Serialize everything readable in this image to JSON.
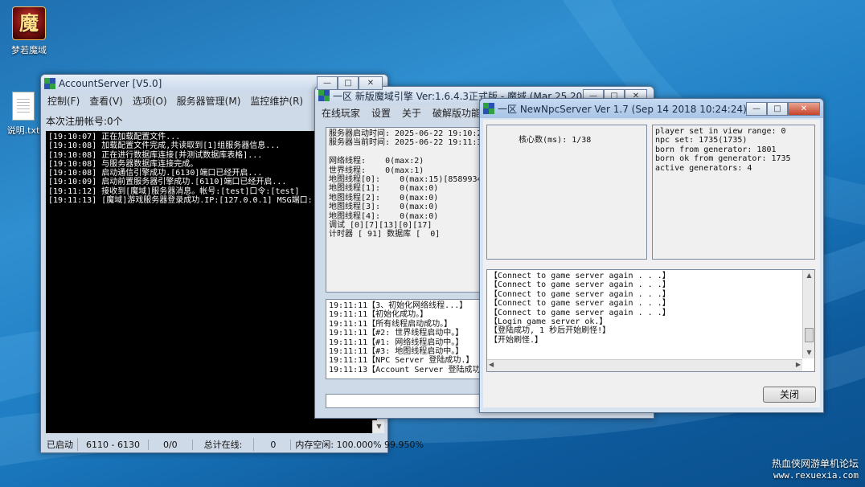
{
  "desktop": {
    "icons": [
      {
        "label": "梦若魔域",
        "glyph": "魔"
      },
      {
        "label": "说明.txt"
      }
    ],
    "watermark": {
      "line1": "热血侠网游单机论坛",
      "line2": "www.rexuexia.com"
    }
  },
  "account_server": {
    "title": "AccountServer [V5.0]",
    "menu": [
      "控制(F)",
      "查看(V)",
      "选项(O)",
      "服务器管理(M)",
      "监控维护(R)"
    ],
    "registered_label": "本次注册帐号:0个",
    "log": "[19:10:07] 正在加载配置文件...\n[19:10:08] 加载配置文件完成,共读取到[1]组服务器信息...\n[19:10:08] 正在进行数据库连接[并测试数据库表格]...\n[19:10:08] 与服务器数据库连接完成。\n[19:10:08] 启动通信引擎成功.[6130]端口已经开启...\n[19:10:09] 启动前置服务器引擎成功.[6110]端口已经开启...\n[19:11:12] 接收到[魔域]服务器消息。帐号:[test]口令:[test]\n[19:11:13] [魔域]游戏服务器登录成功.IP:[127.0.0.1] MSG端口: [58",
    "status": {
      "state": "已启动",
      "ports": "6110 - 6130",
      "ratio": "0/0",
      "online_label": "总计在线:",
      "online_value": "0",
      "memory": "内存空闲: 100.000% 99.950%"
    }
  },
  "engine": {
    "title": "一区 新版魔域引擎 Ver:1.6.4.3正式版 - 魔域 (Mar 25 2019 12:",
    "menu": [
      "在线玩家",
      "设置",
      "关于",
      "破解版功能设置"
    ],
    "stats": "服务器启动时间: 2025-06-22 19:10:20\n服务器当前时间: 2025-06-22 19:11:35\n\n网络线程:    0(max:2)\n世界线程:    0(max:1)\n地图线程[0]:    0(max:15)[858993460]\n地图线程[1]:    0(max:0)\n地图线程[2]:    0(max:0)\n地图线程[3]:    0(max:0)\n地图线程[4]:    0(max:0)\n调试 [0][7][13][0][17]\n计时器 [ 91] 数据库 [  0]",
    "log": "19:11:11【3、初始化网络线程...】\n19:11:11【初始化成功。】\n19:11:11【所有线程启动成功。】\n19:11:11【#2: 世界线程启动中。】\n19:11:11【#1: 网络线程启动中。】\n19:11:11【#3: 地图线程启动中。】\n19:11:11【NPC Server 登陆成功.】\n19:11:13【Account Server 登陆成功。】",
    "input_value": ""
  },
  "npc_server": {
    "title": "一区 NewNpcServer Ver 1.7 (Sep 14 2018 10:24:24)",
    "core_label": "核心数(ms): 1/38",
    "stats": "player set in view range: 0\nnpc set: 1735(1735)\nborn from generator: 1801\nborn ok from generator: 1735\nactive generators: 4",
    "log": "【Connect to game server again . . .】\n【Connect to game server again . . .】\n【Connect to game server again . . .】\n【Connect to game server again . . .】\n【Connect to game server again . . .】\n【Login game server ok.】\n【登陆成功, 1 秒后开始刷怪!】\n【开始刷怪.】",
    "close_label": "关闭"
  },
  "caption_buttons": {
    "minimize": "—",
    "maximize": "□",
    "close": "✕"
  }
}
